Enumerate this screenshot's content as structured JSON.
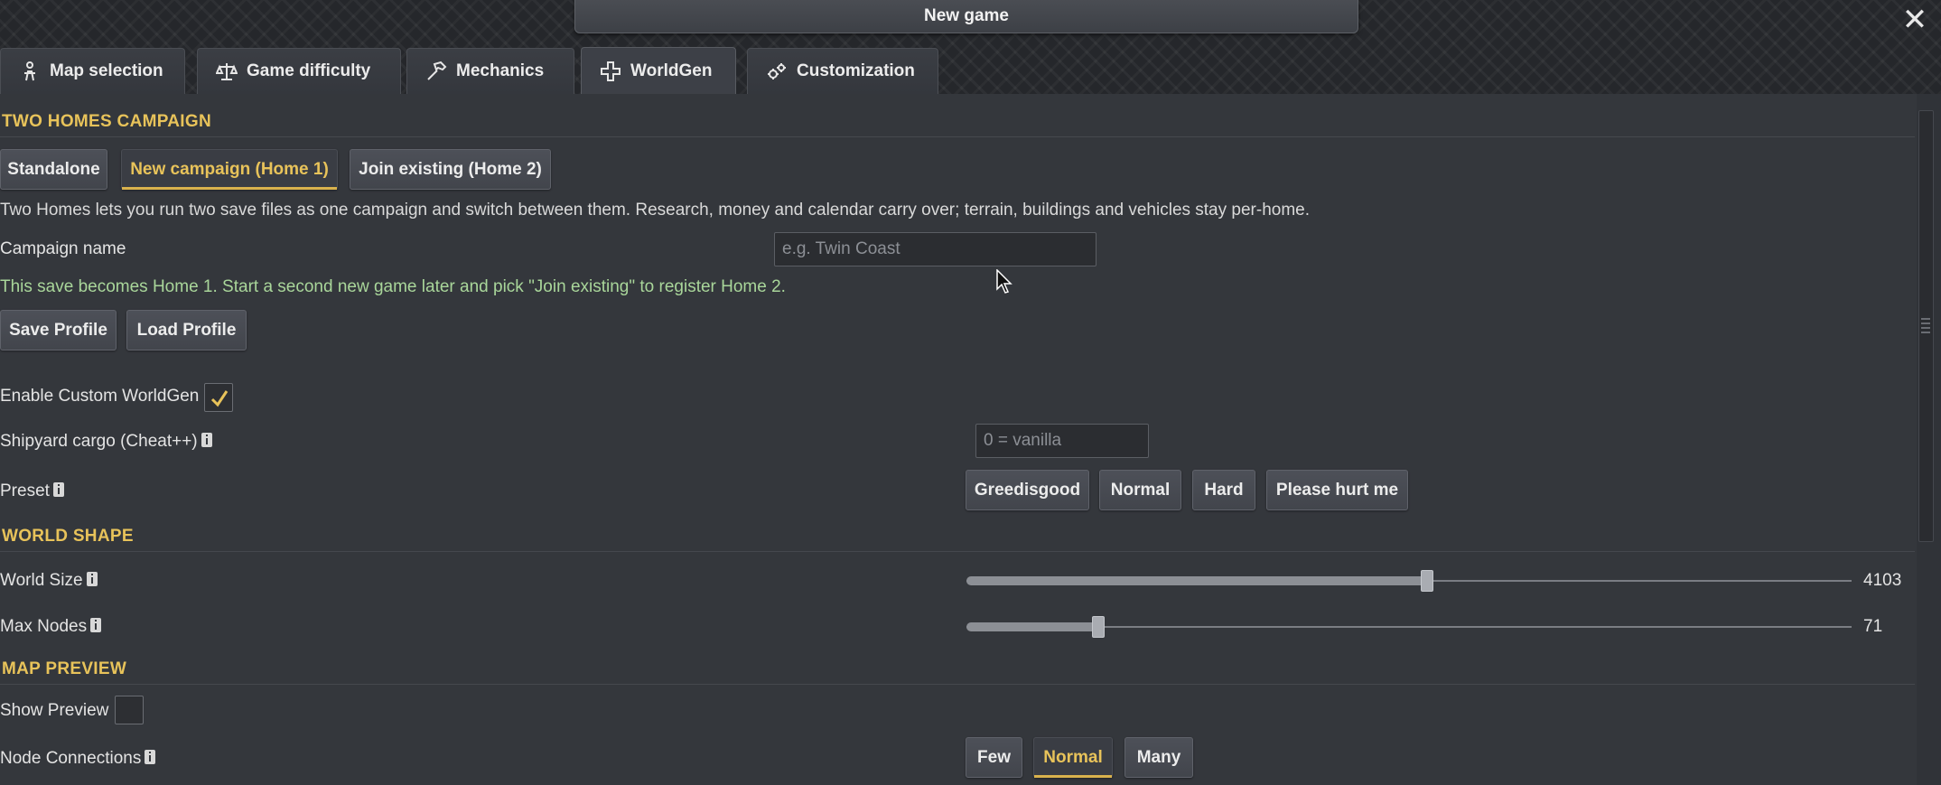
{
  "window": {
    "title": "New game",
    "close_glyph": "✕"
  },
  "tabs": [
    {
      "label": "Map selection",
      "icon": "map-pin-person-icon"
    },
    {
      "label": "Game difficulty",
      "icon": "scales-icon"
    },
    {
      "label": "Mechanics",
      "icon": "hammer-icon"
    },
    {
      "label": "WorldGen",
      "icon": "plus-cross-icon",
      "active": true
    },
    {
      "label": "Customization",
      "icon": "gears-icon"
    }
  ],
  "two_homes": {
    "section_title": "TWO HOMES CAMPAIGN",
    "modes": [
      {
        "label": "Standalone",
        "selected": false
      },
      {
        "label": "New campaign (Home 1)",
        "selected": true
      },
      {
        "label": "Join existing (Home 2)",
        "selected": false
      }
    ],
    "description": "Two Homes lets you run two save files as one campaign and switch between them. Research, money and calendar carry over; terrain, buildings and vehicles stay per-home.",
    "campaign_name_label": "Campaign name",
    "campaign_name_value": "",
    "campaign_name_placeholder": "e.g. Twin Coast",
    "hint": "This save becomes Home 1. Start a second new game later and pick \"Join existing\" to register Home 2.",
    "save_profile": "Save Profile",
    "load_profile": "Load Profile"
  },
  "worldgen": {
    "enable_label": "Enable Custom WorldGen",
    "enable_checked": true,
    "shipyard_label": "Shipyard cargo (Cheat++)",
    "shipyard_value": "",
    "shipyard_placeholder": "0 = vanilla",
    "preset_label": "Preset",
    "presets": [
      "Greedisgood",
      "Normal",
      "Hard",
      "Please hurt me"
    ]
  },
  "world_shape": {
    "section_title": "WORLD SHAPE",
    "world_size_label": "World Size",
    "world_size_value": "4103",
    "world_size_fraction": 0.52,
    "max_nodes_label": "Max Nodes",
    "max_nodes_value": "71",
    "max_nodes_fraction": 0.149
  },
  "map_preview": {
    "section_title": "MAP PREVIEW",
    "show_preview_label": "Show Preview",
    "show_preview_checked": false,
    "node_connections_label": "Node Connections",
    "node_options": [
      {
        "label": "Few",
        "selected": false
      },
      {
        "label": "Normal",
        "selected": true
      },
      {
        "label": "Many",
        "selected": false
      }
    ]
  },
  "colors": {
    "accent": "#e8c35a",
    "hint_green": "#a9d69a",
    "background": "#34373c"
  }
}
